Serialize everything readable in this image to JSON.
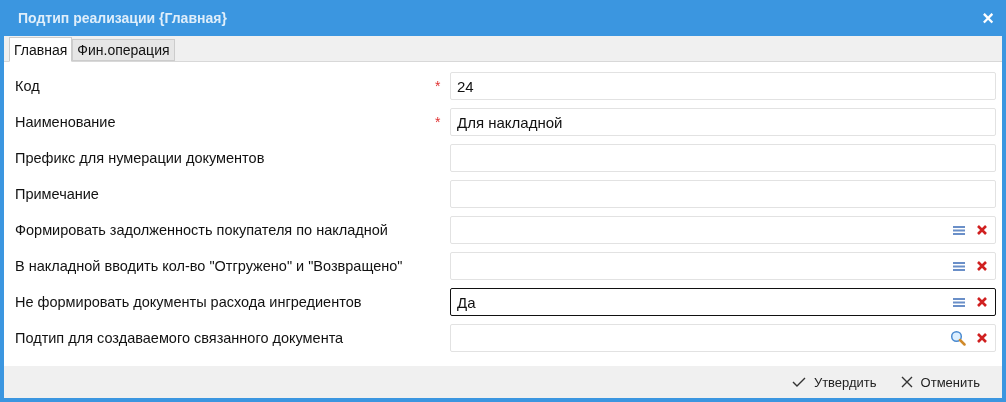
{
  "window": {
    "title": "Подтип реализации {Главная}",
    "close": "×"
  },
  "tabs": [
    {
      "label": "Главная",
      "selected": true
    },
    {
      "label": "Фин.операция",
      "selected": false
    }
  ],
  "fields": [
    {
      "label": "Код",
      "required": true,
      "kind": "text",
      "value": "24",
      "focused": false
    },
    {
      "label": "Наименование",
      "required": true,
      "kind": "text",
      "value": "Для накладной",
      "focused": false
    },
    {
      "label": "Префикс для нумерации документов",
      "required": false,
      "kind": "text",
      "focused": false
    },
    {
      "label": "Примечание",
      "required": false,
      "kind": "text",
      "focused": false
    },
    {
      "label": "Формировать задолженность покупателя по накладной",
      "required": false,
      "kind": "select",
      "focused": false
    },
    {
      "label": "В накладной вводить кол-во \"Отгружено\" и \"Возвращено\"",
      "required": false,
      "kind": "select",
      "focused": false
    },
    {
      "label": "Не формировать документы расхода ингредиентов",
      "required": false,
      "kind": "select",
      "value": "Да",
      "focused": true
    },
    {
      "label": "Подтип для создаваемого связанного документа",
      "required": false,
      "kind": "lookup",
      "focused": false
    }
  ],
  "required_mark": "*",
  "buttons": [
    {
      "label": "Утвердить",
      "kind": "confirm"
    },
    {
      "label": "Отменить",
      "kind": "cancel"
    }
  ]
}
